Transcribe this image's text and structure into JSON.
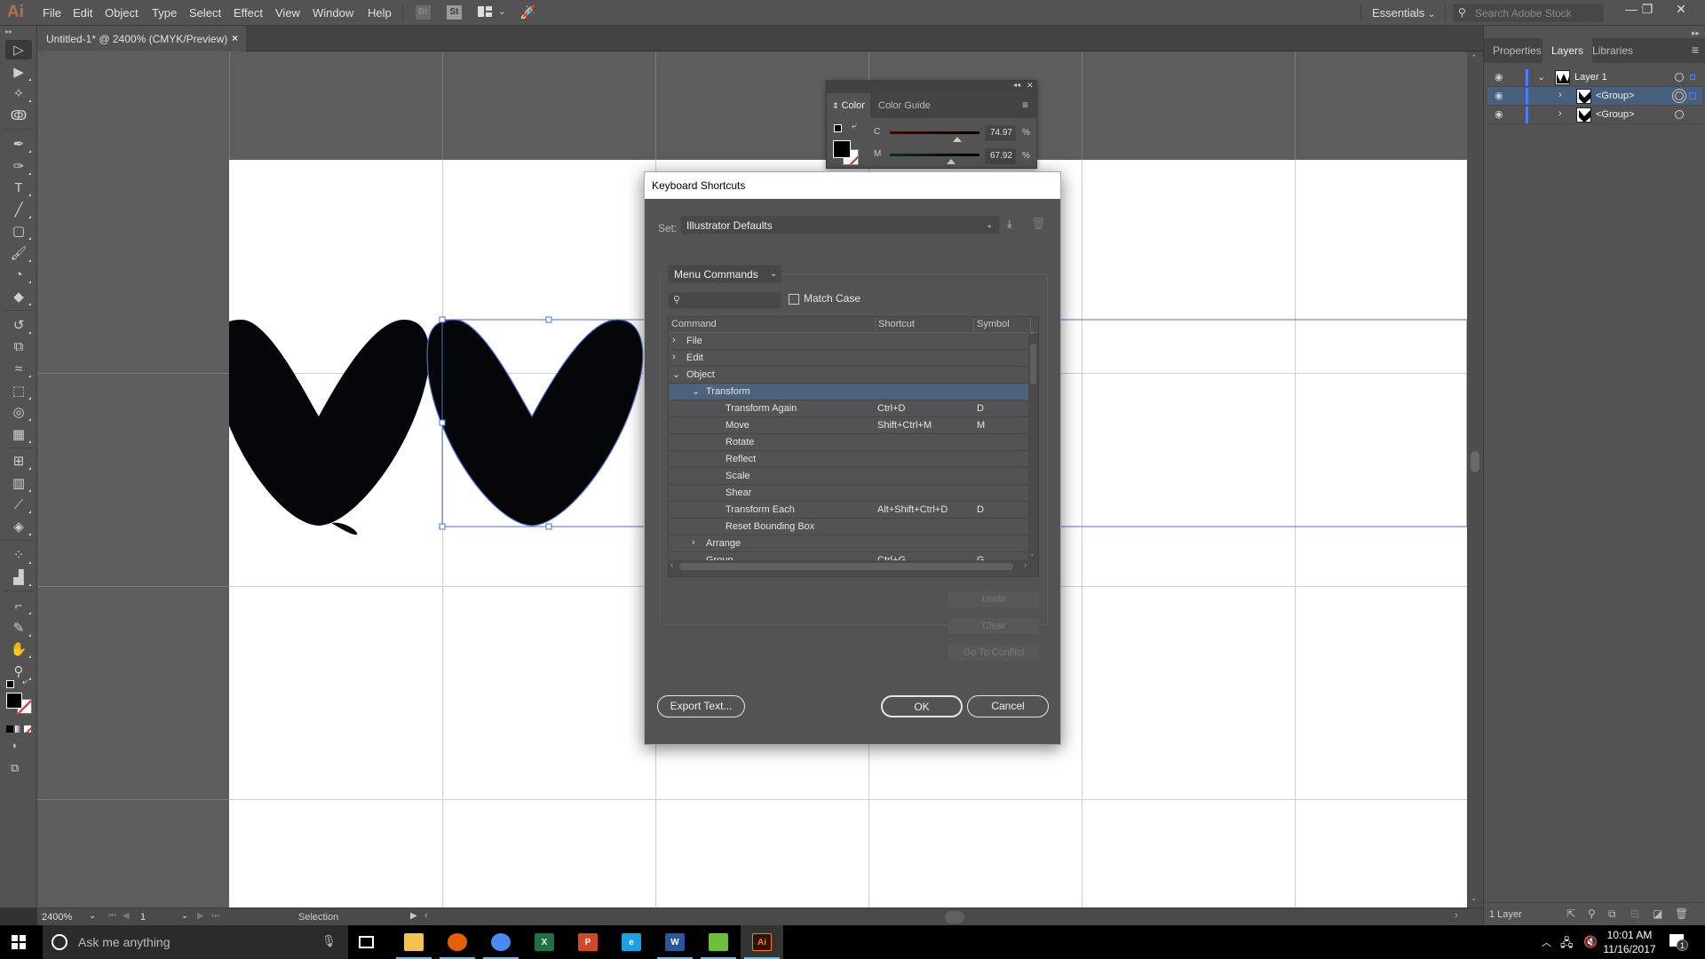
{
  "app": {
    "logo": "Ai",
    "menu": [
      "File",
      "Edit",
      "Object",
      "Type",
      "Select",
      "Effect",
      "View",
      "Window",
      "Help"
    ],
    "toolbar_badges": {
      "bridge": "Br",
      "stock": "St"
    },
    "workspace": "Essentials",
    "stock_search_placeholder": "Search Adobe Stock",
    "window_controls": {
      "minimize": "—",
      "restore": "❐",
      "close": "✕"
    }
  },
  "document_tab": {
    "title": "Untitled-1* @ 2400% (CMYK/Preview)",
    "close": "×"
  },
  "tools": [
    {
      "name": "selection-tool",
      "glyph": "▷"
    },
    {
      "name": "direct-selection-tool",
      "glyph": "▶"
    },
    {
      "name": "magic-wand-tool",
      "glyph": "✧"
    },
    {
      "name": "lasso-tool",
      "glyph": "ↂ"
    },
    {
      "name": "pen-tool",
      "glyph": "✒"
    },
    {
      "name": "curvature-tool",
      "glyph": "✑"
    },
    {
      "name": "type-tool",
      "glyph": "T"
    },
    {
      "name": "line-segment-tool",
      "glyph": "╱"
    },
    {
      "name": "rectangle-tool",
      "glyph": "▢"
    },
    {
      "name": "paintbrush-tool",
      "glyph": "🖌"
    },
    {
      "name": "shaper-tool",
      "glyph": "◔"
    },
    {
      "name": "eraser-tool",
      "glyph": "◆"
    },
    {
      "name": "rotate-tool",
      "glyph": "↺"
    },
    {
      "name": "scale-tool",
      "glyph": "⧉"
    },
    {
      "name": "warp-tool",
      "glyph": "≈"
    },
    {
      "name": "free-transform-tool",
      "glyph": "⬚"
    },
    {
      "name": "shape-builder-tool",
      "glyph": "◎"
    },
    {
      "name": "perspective-grid-tool",
      "glyph": "▦"
    },
    {
      "name": "mesh-tool",
      "glyph": "⊞"
    },
    {
      "name": "gradient-tool",
      "glyph": "▥"
    },
    {
      "name": "eyedropper-tool",
      "glyph": "⟋"
    },
    {
      "name": "blend-tool",
      "glyph": "◈"
    },
    {
      "name": "symbol-sprayer-tool",
      "glyph": "⁘"
    },
    {
      "name": "column-graph-tool",
      "glyph": "▟"
    },
    {
      "name": "artboard-tool",
      "glyph": "⌐"
    },
    {
      "name": "slice-tool",
      "glyph": "✎"
    },
    {
      "name": "hand-tool",
      "glyph": "✋"
    },
    {
      "name": "zoom-tool",
      "glyph": "⚲"
    }
  ],
  "status_bar": {
    "zoom": "2400%",
    "artboard_number": "1",
    "current_tool": "Selection"
  },
  "color_panel": {
    "tabs": [
      "Color",
      "Color Guide"
    ],
    "active_tab": "Color",
    "channels": [
      {
        "label": "C",
        "value": "74.97",
        "percent": 74.97,
        "unit": "%"
      },
      {
        "label": "M",
        "value": "67.92",
        "percent": 67.92,
        "unit": "%"
      }
    ],
    "fill_color": "#000000"
  },
  "right_panel": {
    "tabs": [
      "Properties",
      "Layers",
      "Libraries"
    ],
    "active_tab": "Layers",
    "layers": [
      {
        "name": "Layer 1",
        "level": 0,
        "expanded": true,
        "selected": false
      },
      {
        "name": "<Group>",
        "level": 1,
        "expanded": false,
        "selected": true
      },
      {
        "name": "<Group>",
        "level": 1,
        "expanded": false,
        "selected": false
      }
    ],
    "footer_count": "1 Layer"
  },
  "dialog": {
    "title": "Keyboard Shortcuts",
    "set_label": "Set:",
    "set_value": "Illustrator Defaults",
    "category": "Menu Commands",
    "search_value": "",
    "match_case_label": "Match Case",
    "match_case_checked": false,
    "columns": [
      "Command",
      "Shortcut",
      "Symbol"
    ],
    "rows": [
      {
        "command": "File",
        "shortcut": "",
        "symbol": "",
        "indent": 0,
        "expander": "›"
      },
      {
        "command": "Edit",
        "shortcut": "",
        "symbol": "",
        "indent": 0,
        "expander": "›"
      },
      {
        "command": "Object",
        "shortcut": "",
        "symbol": "",
        "indent": 0,
        "expander": "⌄"
      },
      {
        "command": "Transform",
        "shortcut": "",
        "symbol": "",
        "indent": 1,
        "expander": "⌄",
        "selected": true
      },
      {
        "command": "Transform Again",
        "shortcut": "Ctrl+D",
        "symbol": "D",
        "indent": 2,
        "expander": ""
      },
      {
        "command": "Move",
        "shortcut": "Shift+Ctrl+M",
        "symbol": "M",
        "indent": 2,
        "expander": ""
      },
      {
        "command": "Rotate",
        "shortcut": "",
        "symbol": "",
        "indent": 2,
        "expander": ""
      },
      {
        "command": "Reflect",
        "shortcut": "",
        "symbol": "",
        "indent": 2,
        "expander": ""
      },
      {
        "command": "Scale",
        "shortcut": "",
        "symbol": "",
        "indent": 2,
        "expander": ""
      },
      {
        "command": "Shear",
        "shortcut": "",
        "symbol": "",
        "indent": 2,
        "expander": ""
      },
      {
        "command": "Transform Each",
        "shortcut": "Alt+Shift+Ctrl+D",
        "symbol": "D",
        "indent": 2,
        "expander": ""
      },
      {
        "command": "Reset Bounding Box",
        "shortcut": "",
        "symbol": "",
        "indent": 2,
        "expander": ""
      },
      {
        "command": "Arrange",
        "shortcut": "",
        "symbol": "",
        "indent": 1,
        "expander": "›"
      },
      {
        "command": "Group",
        "shortcut": "Ctrl+G",
        "symbol": "G",
        "indent": 1,
        "expander": ""
      }
    ],
    "buttons": {
      "undo": "Undo",
      "clear": "Clear",
      "go_to_conflict": "Go To Conflict",
      "export_text": "Export Text...",
      "ok": "OK",
      "cancel": "Cancel"
    }
  },
  "taskbar": {
    "search_placeholder": "Ask me anything",
    "apps": [
      {
        "name": "file-explorer",
        "label": "",
        "color": "#f3c24f",
        "running": true
      },
      {
        "name": "firefox",
        "label": "",
        "color": "#e66000",
        "running": true
      },
      {
        "name": "chrome",
        "label": "",
        "color": "#4a8af4",
        "running": true
      },
      {
        "name": "excel",
        "label": "X",
        "color": "#1e7145",
        "running": false
      },
      {
        "name": "powerpoint",
        "label": "P",
        "color": "#d24726",
        "running": false
      },
      {
        "name": "internet-explorer",
        "label": "e",
        "color": "#1ea1e1",
        "running": false
      },
      {
        "name": "word",
        "label": "W",
        "color": "#2b579a",
        "running": true
      },
      {
        "name": "greenshot",
        "label": "",
        "color": "#6dbf3a",
        "running": true
      },
      {
        "name": "illustrator",
        "label": "Ai",
        "color": "#ff7c00",
        "running": true,
        "active": true
      }
    ],
    "time": "10:01 AM",
    "date": "11/16/2017",
    "notification_count": "1"
  }
}
